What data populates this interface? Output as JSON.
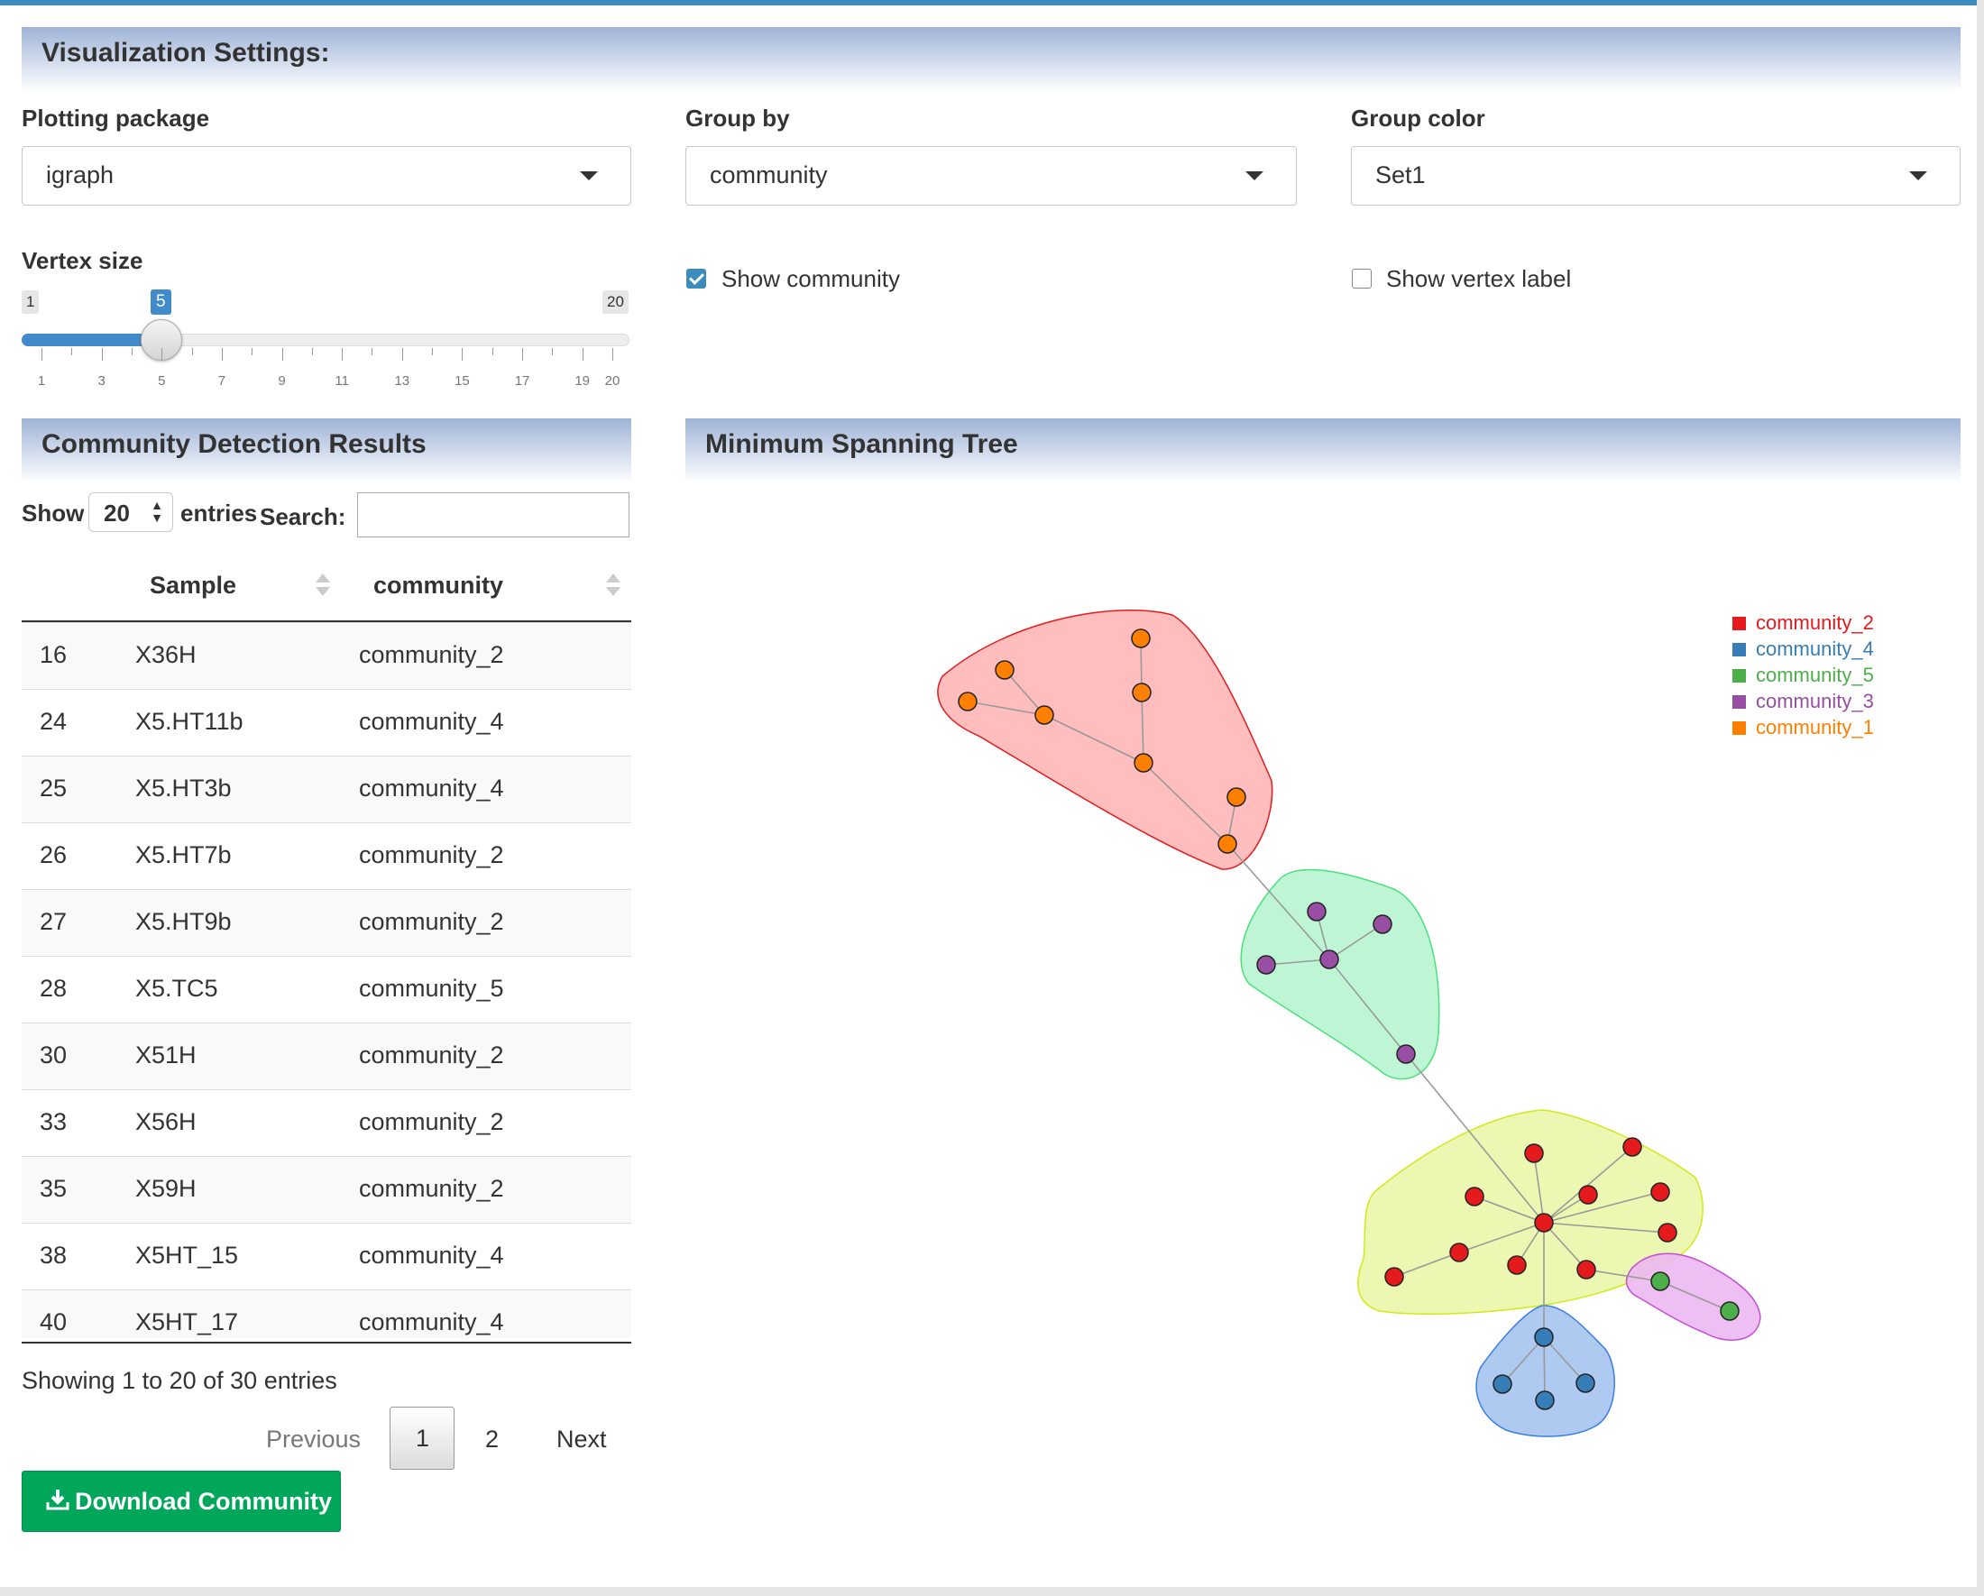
{
  "settings": {
    "title": "Visualization Settings:",
    "plotting_package": {
      "label": "Plotting package",
      "value": "igraph"
    },
    "group_by": {
      "label": "Group by",
      "value": "community"
    },
    "group_color": {
      "label": "Group color",
      "value": "Set1"
    },
    "vertex_size": {
      "label": "Vertex size",
      "min": 1,
      "max": 20,
      "value": 5,
      "min_label": "1",
      "max_label": "20",
      "value_label": "5",
      "tick_labels": [
        "1",
        "3",
        "5",
        "7",
        "9",
        "11",
        "13",
        "15",
        "17",
        "19",
        "20"
      ]
    },
    "show_community": {
      "label": "Show community",
      "checked": true
    },
    "show_vertex_label": {
      "label": "Show vertex label",
      "checked": false
    }
  },
  "results": {
    "title": "Community Detection Results",
    "show_label": "Show",
    "entries_value": "20",
    "entries_label": "entries",
    "search_label": "Search:",
    "search_value": "",
    "columns": [
      "Sample",
      "community"
    ],
    "rows": [
      [
        "16",
        "X36H",
        "community_2"
      ],
      [
        "24",
        "X5.HT11b",
        "community_4"
      ],
      [
        "25",
        "X5.HT3b",
        "community_4"
      ],
      [
        "26",
        "X5.HT7b",
        "community_2"
      ],
      [
        "27",
        "X5.HT9b",
        "community_2"
      ],
      [
        "28",
        "X5.TC5",
        "community_5"
      ],
      [
        "30",
        "X51H",
        "community_2"
      ],
      [
        "33",
        "X56H",
        "community_2"
      ],
      [
        "35",
        "X59H",
        "community_2"
      ],
      [
        "38",
        "X5HT_15",
        "community_4"
      ],
      [
        "40",
        "X5HT_17",
        "community_4"
      ]
    ],
    "info": "Showing 1 to 20 of 30 entries",
    "pagination": {
      "previous": "Previous",
      "pages": [
        "1",
        "2"
      ],
      "current": "1",
      "next": "Next"
    },
    "download_label": "Download Community"
  },
  "mst": {
    "title": "Minimum Spanning Tree",
    "legend": [
      {
        "name": "community_2",
        "color": "#e41a1c"
      },
      {
        "name": "community_4",
        "color": "#377eb8"
      },
      {
        "name": "community_5",
        "color": "#4daf4a"
      },
      {
        "name": "community_3",
        "color": "#984ea3"
      },
      {
        "name": "community_1",
        "color": "#ff7f00"
      }
    ]
  }
}
